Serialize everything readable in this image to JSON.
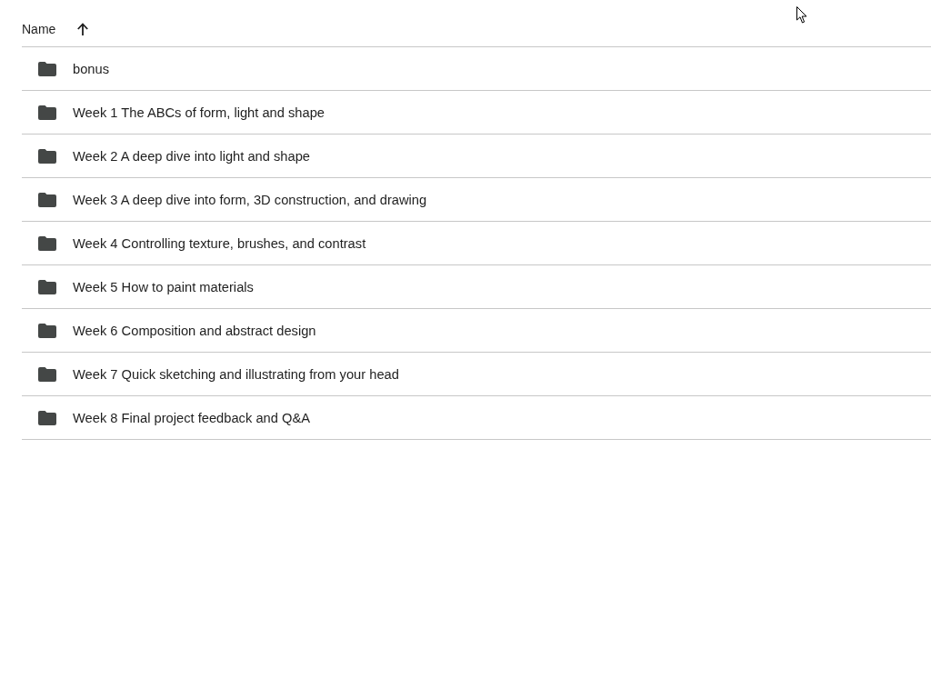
{
  "table": {
    "columns": [
      {
        "label": "Name",
        "sort_ascending": true
      }
    ],
    "rows": [
      {
        "kind": "folder",
        "name": "bonus"
      },
      {
        "kind": "folder",
        "name": "Week 1 The ABCs of form, light and shape"
      },
      {
        "kind": "folder",
        "name": "Week 2 A deep dive into light and shape"
      },
      {
        "kind": "folder",
        "name": "Week 3 A deep dive into form, 3D construction, and drawing"
      },
      {
        "kind": "folder",
        "name": "Week 4 Controlling texture, brushes, and contrast"
      },
      {
        "kind": "folder",
        "name": "Week 5 How to paint materials"
      },
      {
        "kind": "folder",
        "name": "Week 6 Composition and abstract design"
      },
      {
        "kind": "folder",
        "name": "Week 7 Quick sketching and illustrating from your head"
      },
      {
        "kind": "folder",
        "name": "Week 8 Final project feedback and Q&A"
      }
    ]
  }
}
